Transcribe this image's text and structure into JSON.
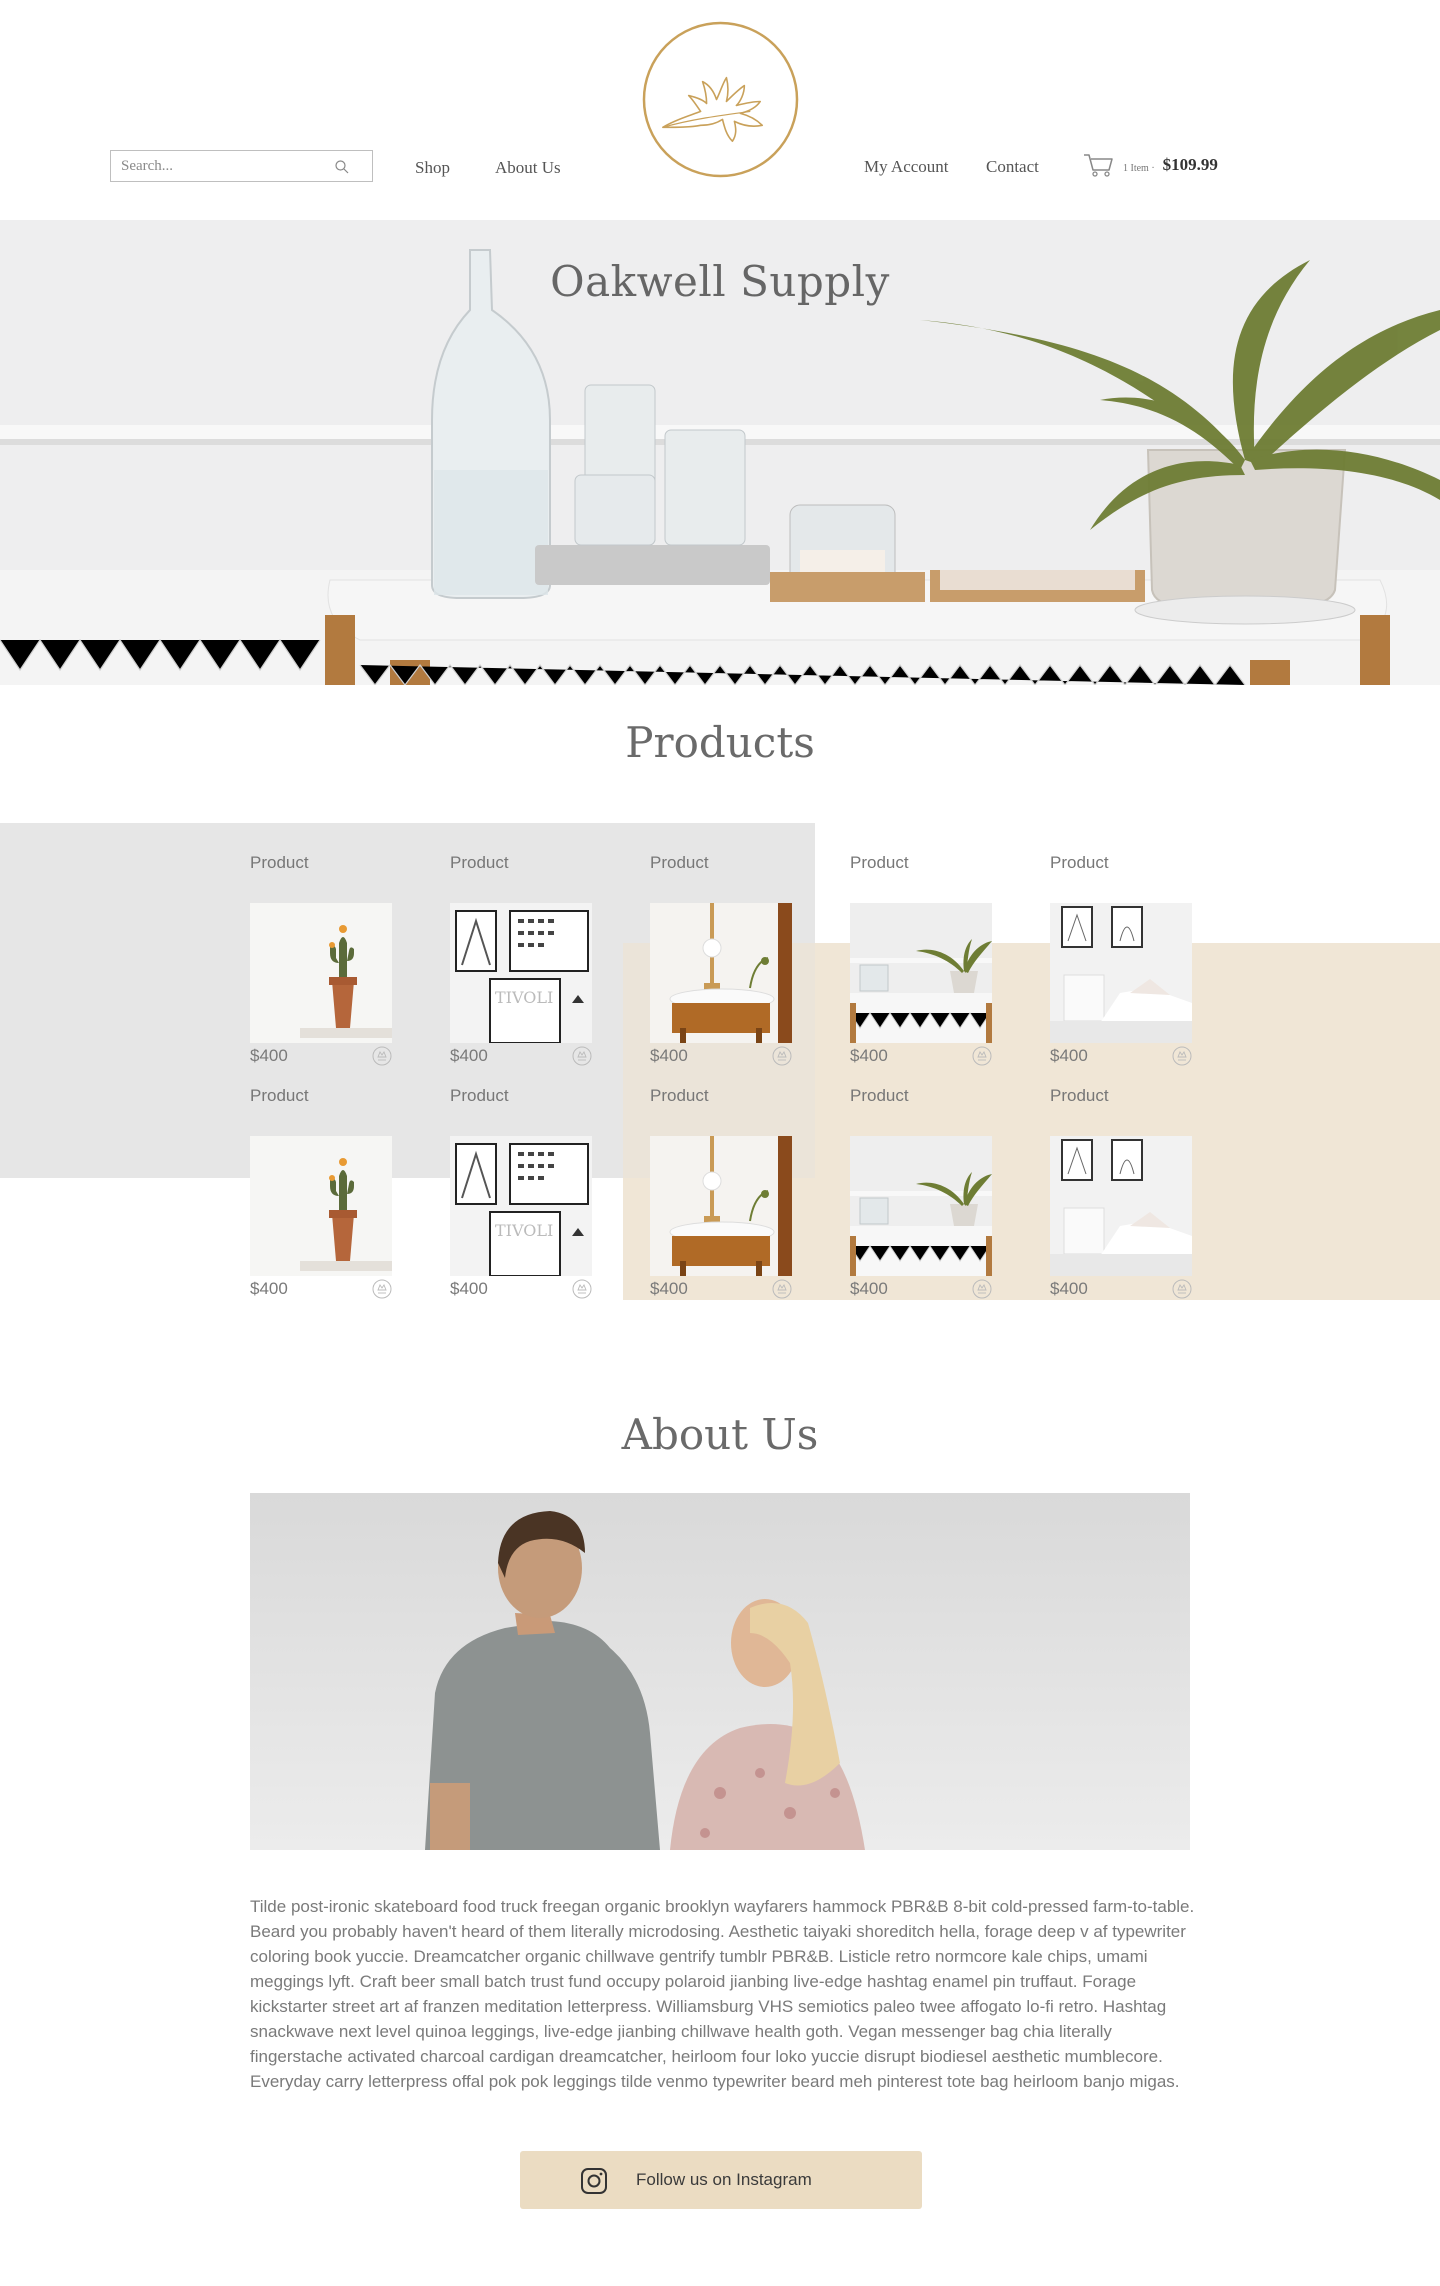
{
  "header": {
    "search_placeholder": "Search...",
    "nav_left": [
      "Shop",
      "About Us"
    ],
    "nav_right": [
      "My Account",
      "Contact"
    ],
    "cart_count": "1 Item ·",
    "cart_total": "$109.99",
    "logo_icon": "oak-leaf-icon"
  },
  "hero": {
    "title": "Oakwell Supply"
  },
  "products": {
    "title": "Products",
    "items": [
      {
        "label": "Product",
        "price": "$400",
        "image": "cactus"
      },
      {
        "label": "Product",
        "price": "$400",
        "image": "posters"
      },
      {
        "label": "Product",
        "price": "$400",
        "image": "lamp-table"
      },
      {
        "label": "Product",
        "price": "$400",
        "image": "cart-plant"
      },
      {
        "label": "Product",
        "price": "$400",
        "image": "bedroom"
      },
      {
        "label": "Product",
        "price": "$400",
        "image": "cactus"
      },
      {
        "label": "Product",
        "price": "$400",
        "image": "posters"
      },
      {
        "label": "Product",
        "price": "$400",
        "image": "lamp-table"
      },
      {
        "label": "Product",
        "price": "$400",
        "image": "cart-plant"
      },
      {
        "label": "Product",
        "price": "$400",
        "image": "bedroom"
      }
    ]
  },
  "about": {
    "title": "About Us",
    "text": "Tilde post-ironic skateboard food truck freegan organic brooklyn wayfarers hammock PBR&B 8-bit cold-pressed farm-to-table. Beard you probably haven't heard of them literally microdosing. Aesthetic taiyaki shoreditch hella, forage deep v af typewriter coloring book yuccie. Dreamcatcher organic chillwave gentrify tumblr PBR&B. Listicle retro normcore kale chips, umami meggings lyft. Craft beer small batch trust fund occupy polaroid jianbing live-edge hashtag enamel pin truffaut. Forage kickstarter street art af franzen meditation letterpress. Williamsburg VHS semiotics paleo twee affogato lo-fi retro. Hashtag snackwave next level quinoa leggings, live-edge jianbing chillwave health goth. Vegan messenger bag chia literally fingerstache activated charcoal cardigan dreamcatcher, heirloom four loko yuccie disrupt biodiesel aesthetic mumblecore. Everyday carry letterpress offal pok pok leggings tilde venmo typewriter beard meh pinterest tote bag heirloom banjo migas.",
    "instagram_label": "Follow us on Instagram"
  },
  "colors": {
    "accent_gold": "#c9a15a",
    "beige": "#f0e6d6",
    "button": "#ebdcc2"
  }
}
